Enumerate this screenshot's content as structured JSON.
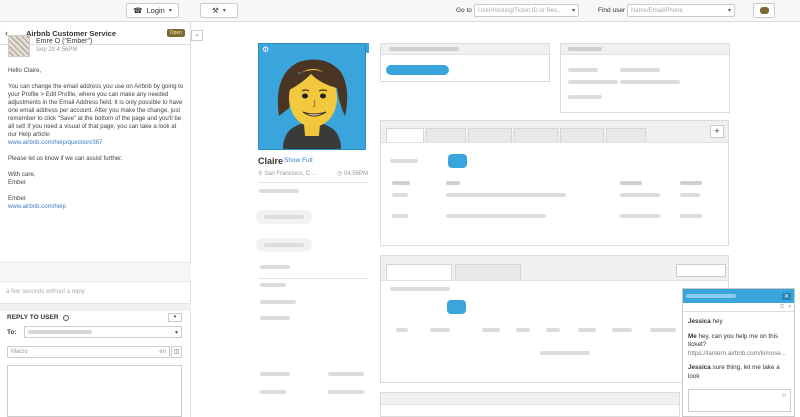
{
  "topbar": {
    "login_label": "Login",
    "goto_label": "Go to",
    "goto_placeholder": "User/Hosting/Ticket ID or Res...",
    "find_user_label": "Find user",
    "find_user_placeholder": "Name/Email/Phone"
  },
  "ticket": {
    "title": "Airbnb Customer Service",
    "status_badge": "Open"
  },
  "message": {
    "sender": "Emre O (\"Ember\")",
    "date": "Sep 29 4:56PM",
    "greeting": "Hello Claire,",
    "body": "You can change the email address you use on Airbnb by going to your Profile > Edit Profile, where you can make any needed adjustments in the Email Address field. It is only possible to have one email address per account. After you make the change, just remember to click \"Save\" at the bottom of the page and you'll be all set! If you need a visual of that page, you can take a look at our Help article:",
    "help_link": "www.airbnb.com/help/question/367",
    "closing": "Please let us know if we can assist further.",
    "signoff_1": "With care,",
    "signoff_2": "Ember",
    "signature_name": "Ember",
    "signature_link": "www.airbnb.com/help"
  },
  "status_note": "a few seconds without a reply",
  "reply": {
    "title": "REPLY TO USER",
    "to_label": "To:",
    "macro_placeholder": "Macro",
    "macro_lang": "en"
  },
  "profile": {
    "name": "Claire",
    "show_full": "Show Full",
    "location": "San Francisco, C...",
    "local_time": "04:58PM"
  },
  "chat": {
    "messages": [
      {
        "sender": "Jessica",
        "text": "hey"
      },
      {
        "sender": "Me",
        "text": "hey, can you help me on this ticket?"
      },
      {
        "sender": "",
        "text": "https://lantern.airbnb.com/kimose..."
      },
      {
        "sender": "Jessica",
        "text": "sure thing, let me take a look"
      }
    ]
  },
  "colors": {
    "accent": "#3aa5dd",
    "link": "#3a7ec6",
    "badge_bg": "#7a6a35"
  },
  "icons": [
    "phone-icon",
    "tools-icon",
    "back-arrow-icon",
    "gear-icon",
    "clock-icon",
    "location-pin-icon",
    "plus-icon",
    "smiley-icon"
  ]
}
